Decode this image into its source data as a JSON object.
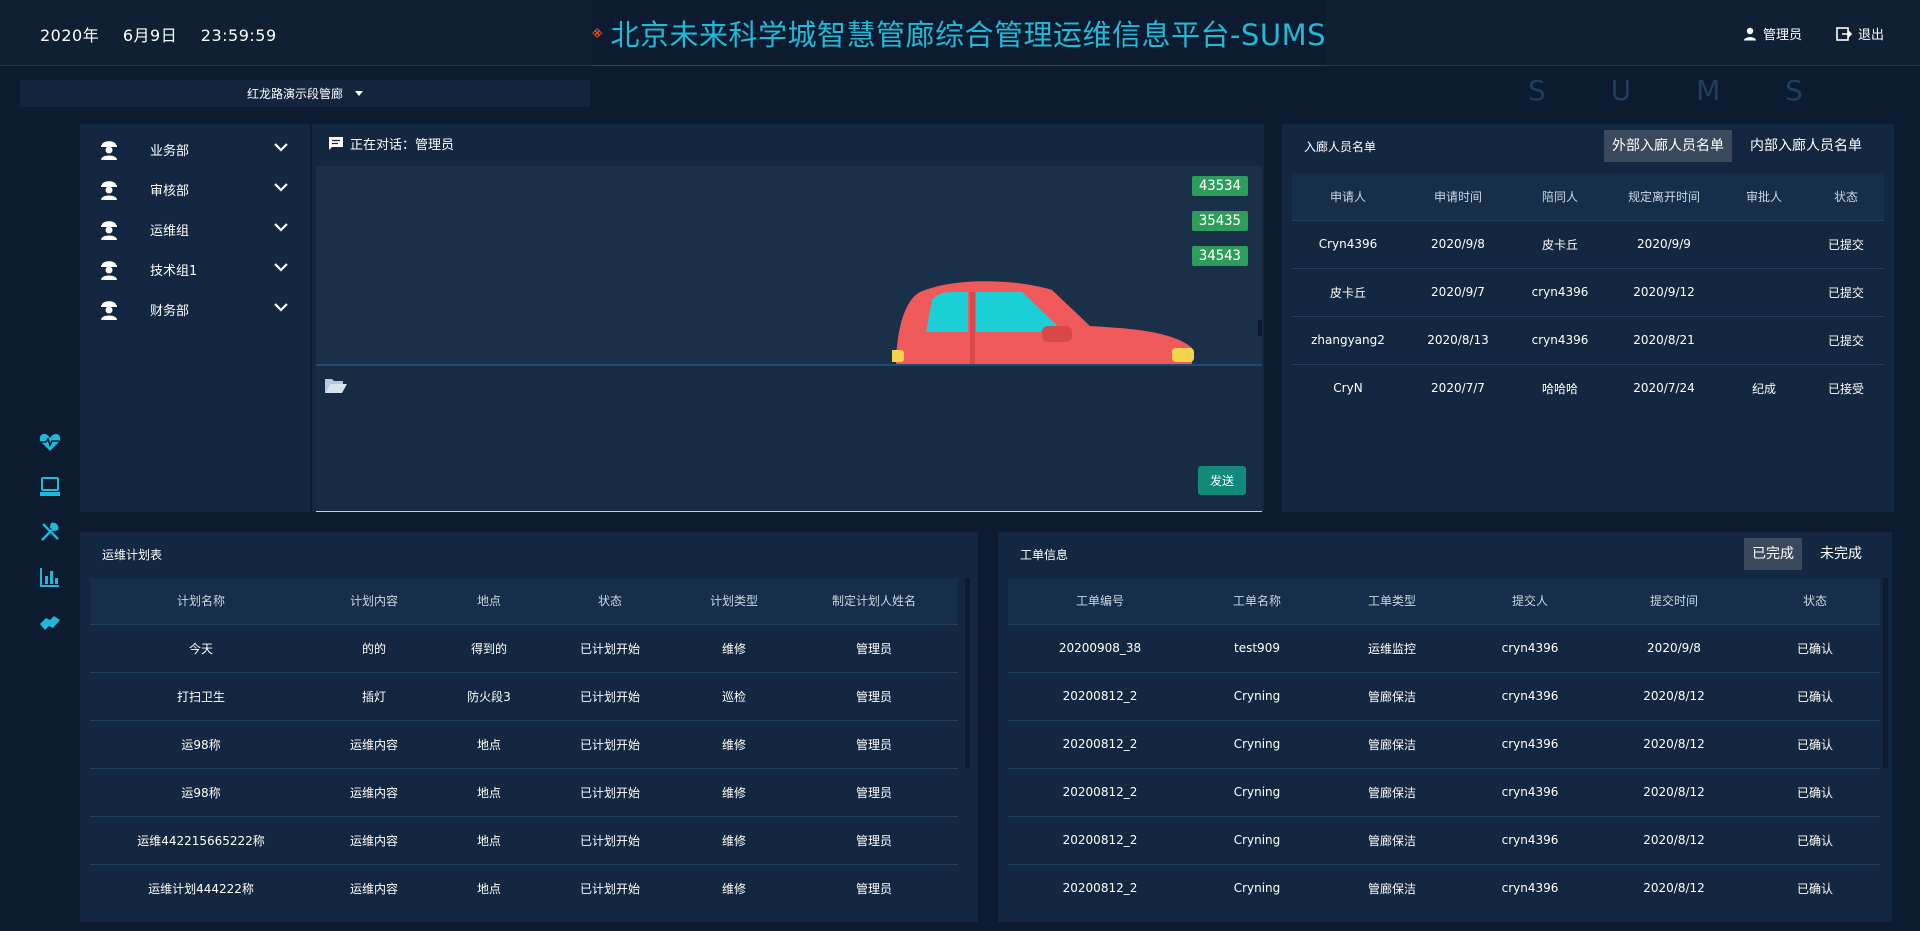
{
  "header": {
    "year": "2020年",
    "date": "6月9日",
    "time": "23:59:59",
    "title": "北京未来科学城智慧管廊综合管理运维信息平台-SUMS",
    "user": "管理员",
    "logout": "退出",
    "watermark": "S U M S",
    "accent": "#22b8d6",
    "logo_color": "#e8561f"
  },
  "selector": {
    "value": "红龙路演示段管廊"
  },
  "rail": {
    "icons": [
      "heartbeat-icon",
      "computer-icon",
      "tools-icon",
      "bar-chart-icon",
      "handshake-icon"
    ]
  },
  "departments": [
    "业务部",
    "审核部",
    "运维组",
    "技术组1",
    "财务部"
  ],
  "chat": {
    "title": "正在对话：管理员",
    "messages": [
      "43534",
      "35435",
      "34543"
    ],
    "send": "发送"
  },
  "visitors": {
    "title": "入廊人员名单",
    "tabs": [
      "外部入廊人员名单",
      "内部入廊人员名单"
    ],
    "active_tab": 0,
    "columns": [
      "申请人",
      "申请时间",
      "陪同人",
      "规定离开时间",
      "审批人",
      "状态"
    ],
    "rows": [
      [
        "Cryn4396",
        "2020/9/8",
        "皮卡丘",
        "2020/9/9",
        "",
        "已提交"
      ],
      [
        "皮卡丘",
        "2020/9/7",
        "cryn4396",
        "2020/9/12",
        "",
        "已提交"
      ],
      [
        "zhangyang2",
        "2020/8/13",
        "cryn4396",
        "2020/8/21",
        "",
        "已提交"
      ],
      [
        "CryN",
        "2020/7/7",
        "哈哈哈",
        "2020/7/24",
        "纪成",
        "已接受"
      ]
    ]
  },
  "plans": {
    "title": "运维计划表",
    "columns": [
      "计划名称",
      "计划内容",
      "地点",
      "状态",
      "计划类型",
      "制定计划人姓名"
    ],
    "rows": [
      [
        "今天",
        "的的",
        "得到的",
        "已计划开始",
        "维修",
        "管理员"
      ],
      [
        "打扫卫生",
        "插灯",
        "防火段3",
        "已计划开始",
        "巡检",
        "管理员"
      ],
      [
        "运98称",
        "运维内容",
        "地点",
        "已计划开始",
        "维修",
        "管理员"
      ],
      [
        "运98称",
        "运维内容",
        "地点",
        "已计划开始",
        "维修",
        "管理员"
      ],
      [
        "运维442215665222称",
        "运维内容",
        "地点",
        "已计划开始",
        "维修",
        "管理员"
      ],
      [
        "运维计划444222称",
        "运维内容",
        "地点",
        "已计划开始",
        "维修",
        "管理员"
      ]
    ]
  },
  "orders": {
    "title": "工单信息",
    "tabs": [
      "已完成",
      "未完成"
    ],
    "active_tab": 0,
    "columns": [
      "工单编号",
      "工单名称",
      "工单类型",
      "提交人",
      "提交时间",
      "状态"
    ],
    "rows": [
      [
        "20200908_38",
        "test909",
        "运维监控",
        "cryn4396",
        "2020/9/8",
        "已确认"
      ],
      [
        "20200812_2",
        "Cryning",
        "管廊保洁",
        "cryn4396",
        "2020/8/12",
        "已确认"
      ],
      [
        "20200812_2",
        "Cryning",
        "管廊保洁",
        "cryn4396",
        "2020/8/12",
        "已确认"
      ],
      [
        "20200812_2",
        "Cryning",
        "管廊保洁",
        "cryn4396",
        "2020/8/12",
        "已确认"
      ],
      [
        "20200812_2",
        "Cryning",
        "管廊保洁",
        "cryn4396",
        "2020/8/12",
        "已确认"
      ],
      [
        "20200812_2",
        "Cryning",
        "管廊保洁",
        "cryn4396",
        "2020/8/12",
        "已确认"
      ]
    ]
  }
}
